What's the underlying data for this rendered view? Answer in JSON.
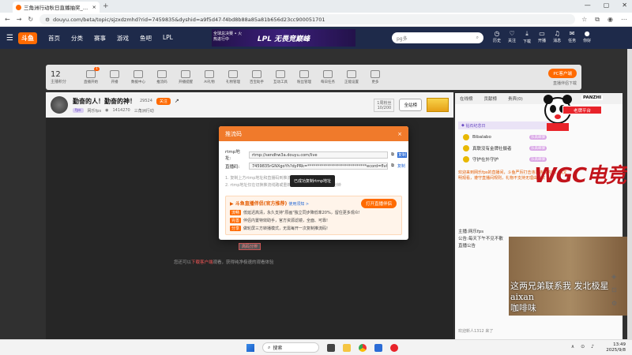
{
  "browser": {
    "tab_title": "三角洲行动秋日直播抽奖_网乐fps",
    "url": "douyu.com/beta/topic/sjzxdzmhd?rid=7459835&dyshid=a9f5d47-f4bd8b88a85a81b656d23cc900051701"
  },
  "site": {
    "logo": "斗鱼",
    "nav": [
      "首页",
      "分类",
      "赛事",
      "游戏",
      "鱼吧",
      "LPL"
    ],
    "banner_title": "LPL 无畏竞巅峰",
    "banner_sub": "全球总决赛 • 火热进行中",
    "search_placeholder": "pg多",
    "header_icons": [
      "历史",
      "关注",
      "下载",
      "开播",
      "消息",
      "任务",
      "你好"
    ]
  },
  "toolbar": {
    "level": "12",
    "level_label": "主播积分",
    "items": [
      "直播开始",
      "开播",
      "数据中心",
      "推流码",
      "开播提醒",
      "AI礼物",
      "礼物管理",
      "百宝助手",
      "互动工具",
      "粉丝管理",
      "每日任务",
      "正能设置",
      "更多"
    ],
    "badge_count": "1",
    "pc_button": "PC客户端",
    "pc_sub": "直播伴侣下载"
  },
  "streamer": {
    "title": "勤奋的人！勤奋的神！",
    "fans": "29524",
    "follow_label": "关注",
    "tag": "fps",
    "name": "网乐fps",
    "viewers": "1414270",
    "category": "三角洲行动",
    "fan_rank": "1周粉丝",
    "fan_rank_value": "10/200",
    "fullscreen_label": "全站榜"
  },
  "modal": {
    "title": "推流码",
    "close": "×",
    "rtmp_label": "rtmp地址:",
    "rtmp_value": "rtmp://sendhw3a.douyu.com/live",
    "rtmp_copy": "复制",
    "code_label": "直播码:",
    "code_value": "7459835rGNXgoYh?dyPRk=******************************ecord=flv&roleshow",
    "code_copy": "复制",
    "tip1": "1. 复制上方rtmp地址和直播码到推流软件的对应位置",
    "tip2": "2. rtmp地址仅在切换推流线路或重新开播时变更，有效期为5分钟",
    "toast": "已成功复制rtmp地址",
    "promo_title": "斗鱼直播伴侣(官方推荐)",
    "promo_link": "使用须知 >",
    "promo_open": "打开直播伴侣",
    "promo_items": [
      {
        "badge": "流畅",
        "text": "低延迟高清，永久支持\"原画\"独立同步降低率20%，留住更多观众!"
      },
      {
        "badge": "完善",
        "text": "伴侣内置特效助手，官方资源滤镜，全面、可靠!"
      },
      {
        "badge": "分享",
        "text": "做轮屏三方转播模式，无需每开一次复制推流码!"
      }
    ]
  },
  "player": {
    "gray_button": "高码分辨",
    "hint_before": "您还可以",
    "hint_link": "下载客户端",
    "hint_after": "观看，获得纯净极速的观看体验"
  },
  "rpanel": {
    "tabs": [
      "在线榜",
      "贡献榜",
      "贵宾(0)"
    ],
    "noble": "钻石纪念日",
    "ranks": [
      {
        "name": "Bibalabo",
        "badge": "乐高邮驿"
      },
      {
        "name": "真联没有金牌社摄者",
        "badge": "乐高邮驿"
      },
      {
        "name": "守护在外守护",
        "badge": "乐高邮驿"
      }
    ],
    "chat_notice": "欢迎来到网乐fps的直播间，斗鱼严厉打击违法违规内容，请文明观看，遵守直播间规则，礼物不支持无理由退款",
    "chat_lines": [
      "主播:网乐fps",
      "公告:每天下午不见不散",
      "直播公告"
    ],
    "bottom": "欢迎新人1312 来了",
    "cam_text": [
      "这两兄弟联系我 发北极星",
      "aixan",
      "咖啡味"
    ]
  },
  "overlay": {
    "mascot_label": "PANZHI",
    "teacher": "老牌平台",
    "watermark": "WGC电竞"
  },
  "taskbar": {
    "search": "搜索",
    "time": "13:49",
    "date": "2025/9/8"
  }
}
